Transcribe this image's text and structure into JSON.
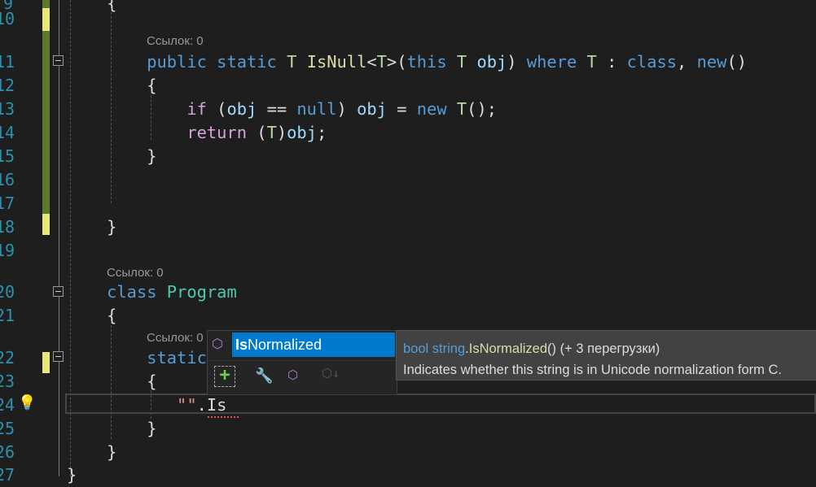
{
  "line_numbers": [
    "9",
    "10",
    "11",
    "12",
    "13",
    "14",
    "15",
    "16",
    "17",
    "18",
    "19",
    "20",
    "21",
    "22",
    "23",
    "24",
    "25",
    "26",
    "27"
  ],
  "codelens": [
    "Ссылок: 0",
    "Ссылок: 0",
    "Ссылок: 0"
  ],
  "code": [
    [
      [
        "    {",
        ""
      ]
    ],
    [
      [
        "",
        ""
      ]
    ],
    [
      [
        "        ",
        ""
      ],
      [
        "public",
        "kw"
      ],
      [
        " ",
        ""
      ],
      [
        "static",
        "kw"
      ],
      [
        " ",
        ""
      ],
      [
        "T",
        "tp"
      ],
      [
        " ",
        ""
      ],
      [
        "IsNull",
        "fn"
      ],
      [
        "<",
        ""
      ],
      [
        "T",
        "tp"
      ],
      [
        ">(",
        ""
      ],
      [
        "this",
        "kw"
      ],
      [
        " ",
        ""
      ],
      [
        "T",
        "tp"
      ],
      [
        " ",
        ""
      ],
      [
        "obj",
        "var"
      ],
      [
        ") ",
        ""
      ],
      [
        "where",
        "kw"
      ],
      [
        " ",
        ""
      ],
      [
        "T",
        "tp"
      ],
      [
        " : ",
        ""
      ],
      [
        "class",
        "kw"
      ],
      [
        ", ",
        ""
      ],
      [
        "new",
        "kw"
      ],
      [
        "()",
        ""
      ]
    ],
    [
      [
        "        {",
        ""
      ]
    ],
    [
      [
        "            ",
        ""
      ],
      [
        "if",
        "ctl"
      ],
      [
        " (",
        ""
      ],
      [
        "obj",
        "var"
      ],
      [
        " == ",
        ""
      ],
      [
        "null",
        "kw"
      ],
      [
        ") ",
        ""
      ],
      [
        "obj",
        "var"
      ],
      [
        " = ",
        ""
      ],
      [
        "new",
        "kw"
      ],
      [
        " ",
        ""
      ],
      [
        "T",
        "tp"
      ],
      [
        "();",
        ""
      ]
    ],
    [
      [
        "            ",
        ""
      ],
      [
        "return",
        "ctl"
      ],
      [
        " (",
        ""
      ],
      [
        "T",
        "tp"
      ],
      [
        ")",
        ""
      ],
      [
        "obj",
        "var"
      ],
      [
        ";",
        ""
      ]
    ],
    [
      [
        "        }",
        ""
      ]
    ],
    [
      [
        "",
        ""
      ]
    ],
    [
      [
        "",
        ""
      ]
    ],
    [
      [
        "    }",
        ""
      ]
    ],
    [
      [
        "",
        ""
      ]
    ],
    [
      [
        "    ",
        ""
      ],
      [
        "class",
        "kw"
      ],
      [
        " ",
        ""
      ],
      [
        "Program",
        "ty"
      ]
    ],
    [
      [
        "    {",
        ""
      ]
    ],
    [
      [
        "        ",
        ""
      ],
      [
        "static",
        "kw"
      ]
    ],
    [
      [
        "        {",
        ""
      ]
    ],
    [
      [
        "           ",
        ""
      ],
      [
        "\"\"",
        "str"
      ],
      [
        ".Is",
        ""
      ]
    ],
    [
      [
        "        }",
        ""
      ]
    ],
    [
      [
        "    }",
        ""
      ]
    ],
    [
      [
        "}",
        ""
      ]
    ]
  ],
  "completion": {
    "selected_item": "IsNormalized",
    "typed_prefix": "Is",
    "rest": "Normalized",
    "icons": [
      "method-cube-icon",
      "snippet-add-icon",
      "wrench-filter-icon",
      "method-filter-icon",
      "extension-filter-icon"
    ]
  },
  "tooltip": {
    "return_type": "bool",
    "type": "string",
    "dot": ".",
    "method": "IsNormalized",
    "signature_rest": "() (+ 3 перегрузки)",
    "description": "Indicates whether this string is in Unicode normalization form C."
  },
  "colors": {
    "background": "#1e1e1e",
    "keyword": "#569cd6",
    "selection": "#007acc",
    "line_number": "#2b91af",
    "changed_saved": "#5d7a2a",
    "changed_unsaved": "#e8e87a"
  }
}
